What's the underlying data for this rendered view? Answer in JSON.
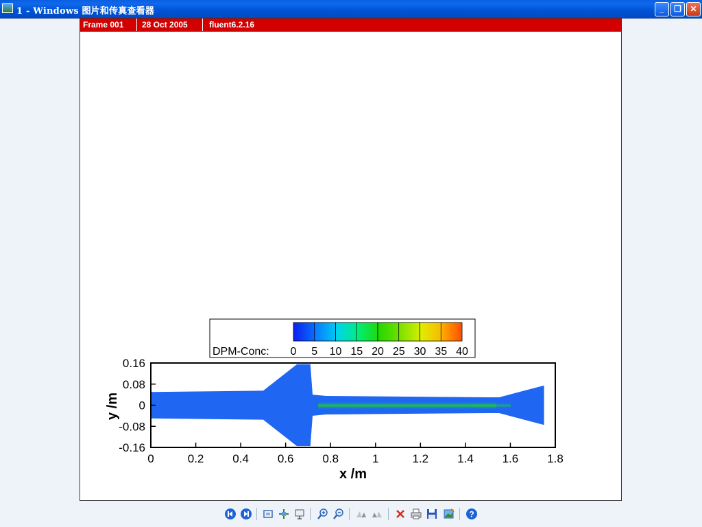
{
  "window": {
    "title": "1 - Windows 图片和传真查看器",
    "min_label": "_",
    "max_label": "❐",
    "close_label": "✕"
  },
  "frame_header": {
    "frame": "Frame 001",
    "date": "28 Oct 2005",
    "software": "fluent6.2.16"
  },
  "colorbar": {
    "label": "DPM-Conc:",
    "ticks": [
      "0",
      "5",
      "10",
      "15",
      "20",
      "25",
      "30",
      "35",
      "40"
    ],
    "colors": [
      "#0d20ef",
      "#0a78ff",
      "#00d2f0",
      "#00ee7a",
      "#22d700",
      "#7ae000",
      "#dff000",
      "#ffb000",
      "#ff3c00"
    ]
  },
  "chart_data": {
    "type": "heatmap",
    "title": "",
    "xlabel": "x /m",
    "ylabel": "y /m",
    "xlim": [
      0,
      1.8
    ],
    "ylim": [
      -0.16,
      0.16
    ],
    "x_ticks": [
      "0",
      "0.2",
      "0.4",
      "0.6",
      "0.8",
      "1",
      "1.2",
      "1.4",
      "1.6",
      "1.8"
    ],
    "y_ticks": [
      "0.16",
      "0.08",
      "0",
      "-0.08",
      "-0.16"
    ],
    "variable": "DPM-Conc",
    "range": [
      0,
      40
    ],
    "domain_outline_m": [
      [
        0,
        0.05
      ],
      [
        0.5,
        0.055
      ],
      [
        0.65,
        0.155
      ],
      [
        0.71,
        0.155
      ],
      [
        0.72,
        0.04
      ],
      [
        0.78,
        0.035
      ],
      [
        1.5,
        0.03
      ],
      [
        1.55,
        0.03
      ],
      [
        1.75,
        0.075
      ],
      [
        1.75,
        -0.075
      ],
      [
        1.55,
        -0.03
      ],
      [
        1.5,
        -0.03
      ],
      [
        0.78,
        -0.035
      ],
      [
        0.72,
        -0.04
      ],
      [
        0.71,
        -0.155
      ],
      [
        0.65,
        -0.155
      ],
      [
        0.5,
        -0.055
      ],
      [
        0,
        -0.05
      ]
    ]
  },
  "toolbar": {
    "buttons": [
      {
        "name": "previous-image-button",
        "icon": "previous-icon"
      },
      {
        "name": "next-image-button",
        "icon": "next-icon"
      },
      {
        "name": "best-fit-button",
        "icon": "best-fit-icon"
      },
      {
        "name": "actual-size-button",
        "icon": "actual-size-icon"
      },
      {
        "name": "slideshow-button",
        "icon": "slideshow-icon"
      },
      {
        "name": "zoom-in-button",
        "icon": "zoom-in-icon"
      },
      {
        "name": "zoom-out-button",
        "icon": "zoom-out-icon"
      },
      {
        "name": "rotate-clockwise-button",
        "icon": "rotate-clockwise-icon"
      },
      {
        "name": "rotate-counterclockwise-button",
        "icon": "rotate-counterclockwise-icon"
      },
      {
        "name": "delete-button",
        "icon": "delete-icon"
      },
      {
        "name": "print-button",
        "icon": "print-icon"
      },
      {
        "name": "save-button",
        "icon": "save-icon"
      },
      {
        "name": "open-for-editing-button",
        "icon": "edit-icon"
      },
      {
        "name": "help-button",
        "icon": "help-icon"
      }
    ]
  }
}
